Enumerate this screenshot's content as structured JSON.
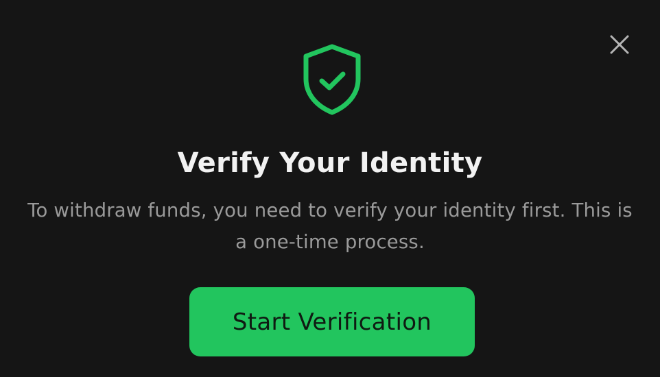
{
  "dialog": {
    "title": "Verify Your Identity",
    "description": "To withdraw funds, you need to verify your identity first. This is a one-time process.",
    "primary_button_label": "Start Verification",
    "close_icon": "close-icon",
    "header_icon": "shield-check-icon"
  },
  "colors": {
    "background": "#151515",
    "accent": "#22c55e",
    "title": "#f2f2f2",
    "description": "#9a9a9a",
    "close_icon": "#b5b5b5",
    "button_text": "#0f1a12"
  }
}
